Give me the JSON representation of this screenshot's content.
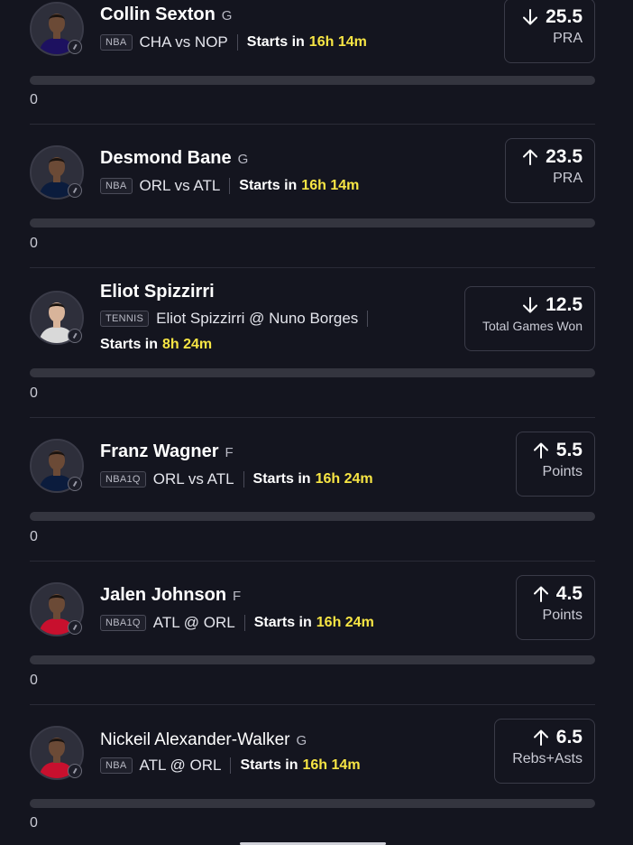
{
  "cards": [
    {
      "player": "Collin Sexton",
      "position": "G",
      "league": "NBA",
      "matchup": "CHA vs NOP",
      "starts_label": "Starts in",
      "starts_time": "16h 14m",
      "direction": "down",
      "line": "25.5",
      "stat": "PRA",
      "progress_fraction": 0,
      "progress_value": "0",
      "jersey_color": "#1d1160"
    },
    {
      "player": "Desmond Bane",
      "position": "G",
      "league": "NBA",
      "matchup": "ORL vs ATL",
      "starts_label": "Starts in",
      "starts_time": "16h 14m",
      "direction": "up",
      "line": "23.5",
      "stat": "PRA",
      "progress_fraction": 0,
      "progress_value": "0",
      "jersey_color": "#0b1c3d"
    },
    {
      "player": "Eliot Spizzirri",
      "position": "",
      "league": "TENNIS",
      "matchup": "Eliot Spizzirri @ Nuno Borges",
      "starts_label": "Starts in",
      "starts_time": "8h 24m",
      "direction": "down",
      "line": "12.5",
      "stat": "Total Games Won",
      "progress_fraction": 0,
      "progress_value": "0",
      "jersey_color": "#d9d9d9"
    },
    {
      "player": "Franz Wagner",
      "position": "F",
      "league": "NBA1Q",
      "matchup": "ORL vs ATL",
      "starts_label": "Starts in",
      "starts_time": "16h 24m",
      "direction": "up",
      "line": "5.5",
      "stat": "Points",
      "progress_fraction": 0,
      "progress_value": "0",
      "jersey_color": "#0b1c3d"
    },
    {
      "player": "Jalen Johnson",
      "position": "F",
      "league": "NBA1Q",
      "matchup": "ATL @ ORL",
      "starts_label": "Starts in",
      "starts_time": "16h 24m",
      "direction": "up",
      "line": "4.5",
      "stat": "Points",
      "progress_fraction": 0,
      "progress_value": "0",
      "jersey_color": "#c8102e"
    },
    {
      "player": "Nickeil Alexander-Walker",
      "position": "G",
      "league": "NBA",
      "matchup": "ATL @ ORL",
      "starts_label": "Starts in",
      "starts_time": "16h 14m",
      "direction": "up",
      "line": "6.5",
      "stat": "Rebs+Asts",
      "progress_fraction": 0,
      "progress_value": "0",
      "jersey_color": "#c8102e"
    }
  ],
  "icons": {
    "arrow_up": "arrow-up-icon",
    "arrow_down": "arrow-down-icon",
    "badge": "clock-badge-icon"
  },
  "colors": {
    "background": "#14151f",
    "accent_time": "#f7e544",
    "progress_track": "#34353f"
  }
}
